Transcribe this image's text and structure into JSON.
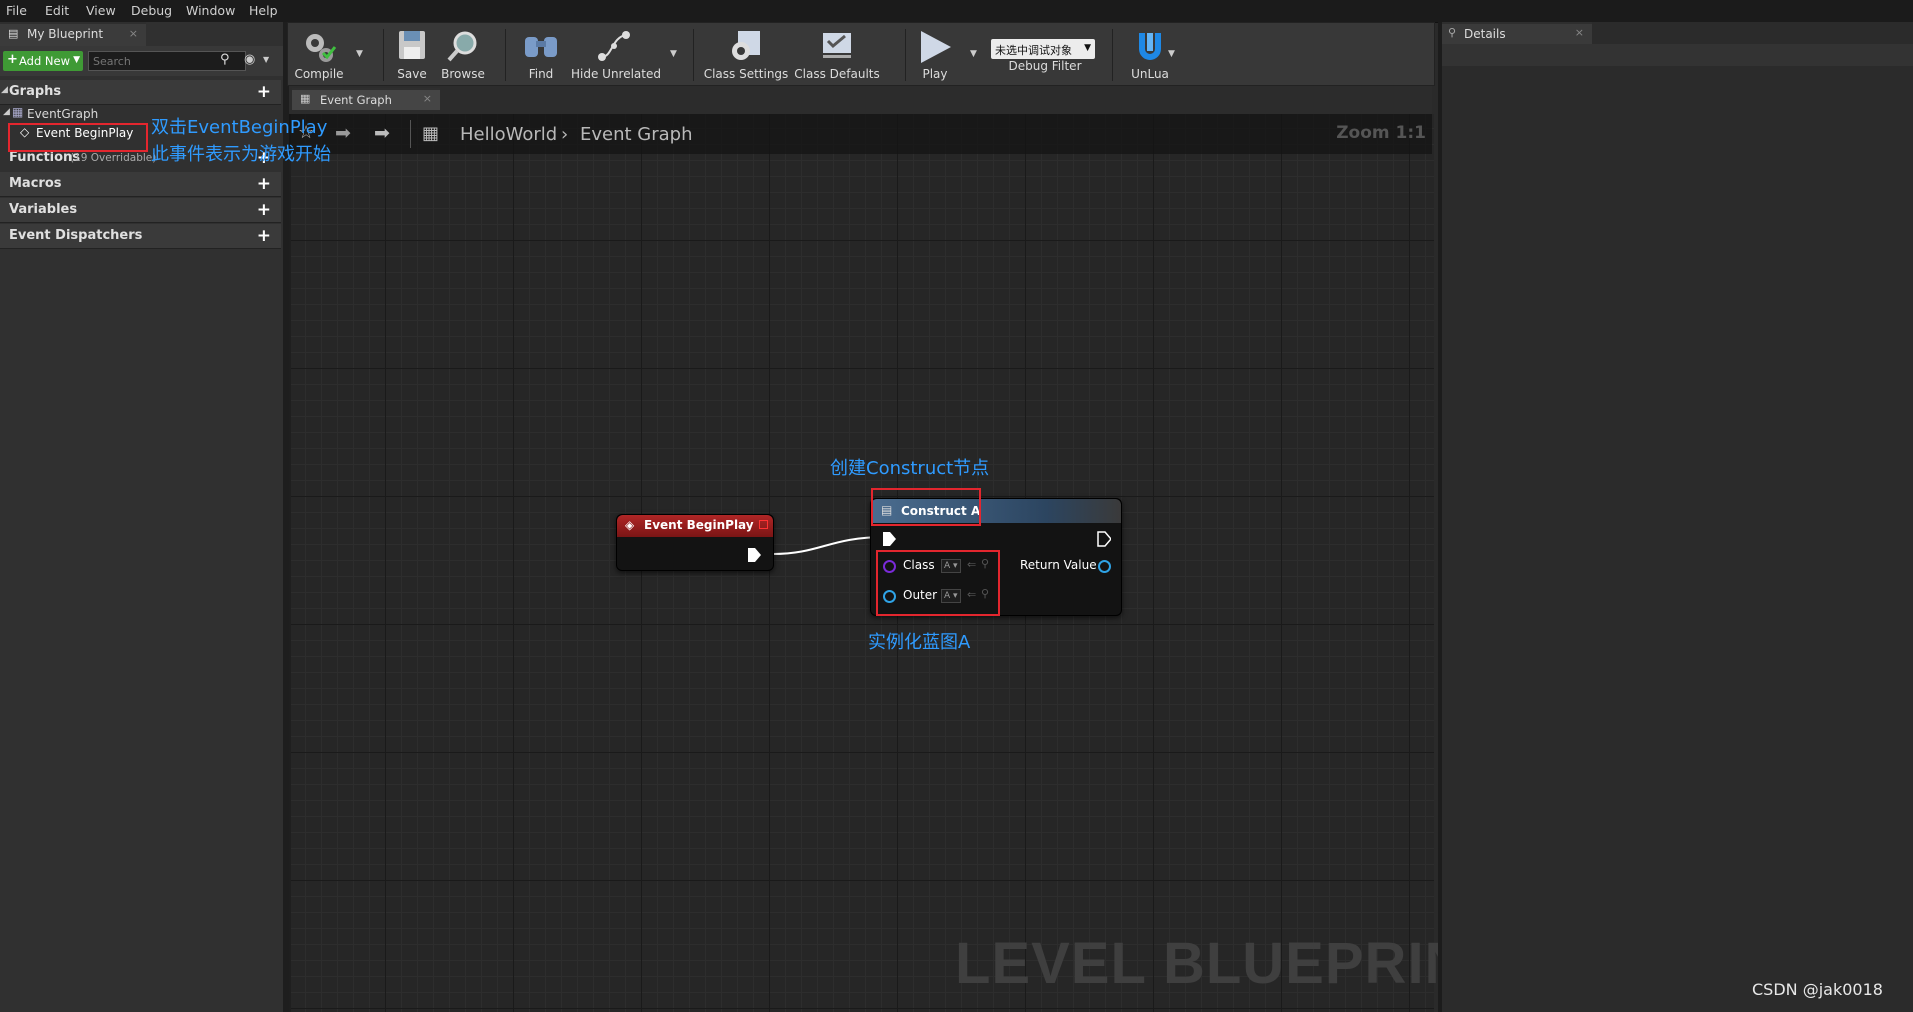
{
  "menu": [
    "File",
    "Edit",
    "View",
    "Debug",
    "Window",
    "Help"
  ],
  "left_panel": {
    "tab_title": "My Blueprint",
    "add_new_label": "Add New",
    "search_placeholder": "Search",
    "sections": {
      "graphs": "Graphs",
      "event_graph": "EventGraph",
      "event_beginplay": "Event BeginPlay",
      "functions": "Functions",
      "functions_note": "(19 Overridable)",
      "macros": "Macros",
      "variables": "Variables",
      "event_dispatchers": "Event Dispatchers"
    }
  },
  "toolbar": {
    "compile": "Compile",
    "save": "Save",
    "browse": "Browse",
    "find": "Find",
    "hide_unrelated": "Hide Unrelated",
    "class_settings": "Class Settings",
    "class_defaults": "Class Defaults",
    "play": "Play",
    "debug_value": "未选中调试对象",
    "debug_filter": "Debug Filter",
    "unlua": "UnLua"
  },
  "graph_tab": "Event Graph",
  "breadcrumb": {
    "root": "HelloWorld",
    "current": "Event Graph"
  },
  "zoom": "Zoom 1:1",
  "watermark": "LEVEL BLUEPRINT",
  "nodes": {
    "begin_play_title": "Event BeginPlay",
    "construct_title": "Construct A",
    "class_pin": "Class",
    "outer_pin": "Outer",
    "pin_value": "A",
    "return_value": "Return Value"
  },
  "annotations": {
    "double_click_1": "双击EventBeginPlay",
    "double_click_2": "此事件表示为游戏开始",
    "create_construct": "创建Construct节点",
    "instantiate": "实例化蓝图A"
  },
  "details_tab": "Details",
  "credit": "CSDN @jak0018",
  "colors": {
    "annotation": "#2f9bff",
    "highlight": "#e3262e",
    "event_header": "#8b1a1a",
    "function_header": "#3d5a78"
  }
}
